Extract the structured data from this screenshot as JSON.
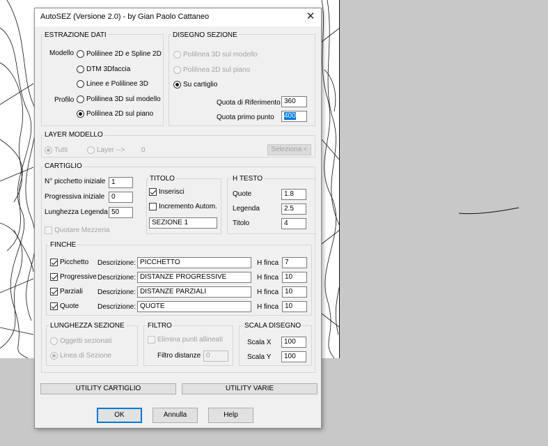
{
  "dialog": {
    "title": "AutoSEZ (Versione 2.0) - by Gian Paolo Cattaneo",
    "close_icon": "close-icon"
  },
  "estrazione": {
    "title": "ESTRAZIONE DATI",
    "modello_label": "Modello",
    "profilo_label": "Profilo",
    "opt_polilinee2d": "Polilinee 2D e Spline 2D",
    "opt_dtm": "DTM 3Dfaccia",
    "opt_linee": "Linee e Polilinee 3D",
    "opt_poli3d_modello": "Polilinea 3D sul modello",
    "opt_poli2d_piano": "Polilinea 2D sul piano"
  },
  "disegno": {
    "title": "DISEGNO SEZIONE",
    "opt_poli3d": "Polilinea 3D sul modello",
    "opt_poli2d": "Polilinea 2D sul piano",
    "opt_cartiglio": "Su cartiglio",
    "quota_rif_label": "Quota di Riferimento",
    "quota_rif_value": "360",
    "quota_primo_label": "Quota primo punto",
    "quota_primo_value": "400"
  },
  "layer": {
    "title": "LAYER MODELLO",
    "opt_tutti": "Tutti",
    "opt_layer": "Layer -->",
    "layer_value": "0",
    "seleziona_btn": "Seleziona <"
  },
  "cartiglio": {
    "title": "CARTIGLIO",
    "picchetto_label": "N° picchetto iniziale",
    "picchetto_value": "1",
    "progressiva_label": "Progressiva iniziale",
    "progressiva_value": "0",
    "lunghezza_label": "Lunghezza Legenda",
    "lunghezza_value": "50",
    "mezzeria_label": "Quotare Mezzeria",
    "titolo": {
      "title": "TITOLO",
      "inserisci": "Inserisci",
      "incremento": "Incremento Autom.",
      "value": "SEZIONE 1"
    },
    "htesto": {
      "title": "H TESTO",
      "quote_label": "Quote",
      "quote_value": "1.8",
      "legenda_label": "Legenda",
      "legenda_value": "2.5",
      "titolo_label": "Titolo",
      "titolo_value": "4"
    }
  },
  "finche": {
    "title": "FINCHE",
    "descr_label": "Descrizione:",
    "hfinca_label": "H finca",
    "rows": [
      {
        "name": "Picchetto",
        "descr": "PICCHETTO",
        "h": "7"
      },
      {
        "name": "Progressive",
        "descr": "DISTANZE PROGRESSIVE",
        "h": "10"
      },
      {
        "name": "Parziali",
        "descr": "DISTANZE PARZIALI",
        "h": "10"
      },
      {
        "name": "Quote",
        "descr": "QUOTE",
        "h": "10"
      }
    ]
  },
  "lunghezza": {
    "title": "LUNGHEZZA SEZIONE",
    "opt_oggetti": "Oggetti sezionati",
    "opt_linea": "Linea di Sezione"
  },
  "filtro": {
    "title": "FILTRO",
    "elimina": "Elimina punti allineati",
    "distanze_label": "Filtro distanze",
    "distanze_value": "0"
  },
  "scala": {
    "title": "SCALA DISEGNO",
    "x_label": "Scala  X",
    "x_value": "100",
    "y_label": "Scala  Y",
    "y_value": "100"
  },
  "buttons": {
    "utility_cartiglio": "UTILITY CARTIGLIO",
    "utility_varie": "UTILITY VARIE",
    "ok": "OK",
    "annulla": "Annulla",
    "help": "Help"
  }
}
